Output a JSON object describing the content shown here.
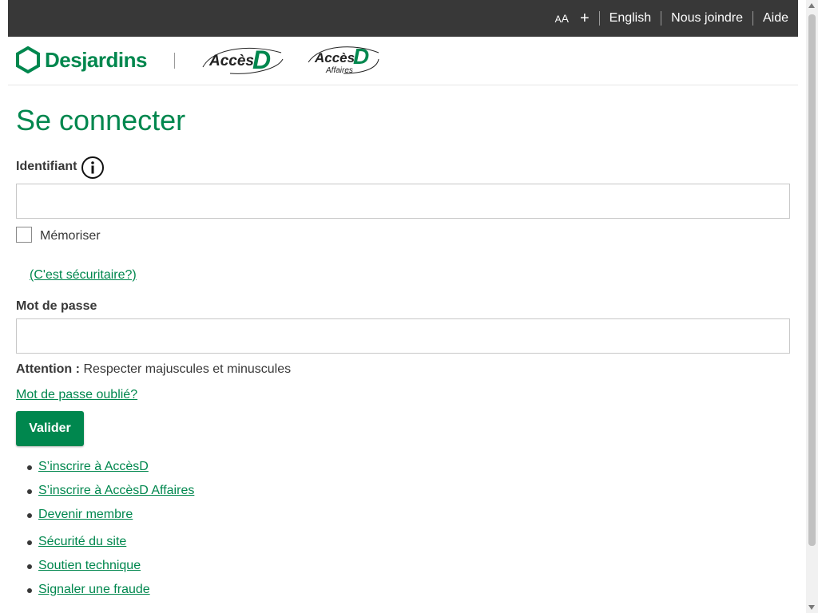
{
  "topbar": {
    "font_size_small": "A",
    "font_size_large": "A",
    "font_size_plus": "+",
    "english": "English",
    "contact": "Nous joindre",
    "help": "Aide"
  },
  "header": {
    "brand": "Desjardins",
    "acces_d_logo": "AccèsD",
    "acces_d_affaires_logo": "AccèsD Affaires"
  },
  "login": {
    "title": "Se connecter",
    "identifier_label": "Identifiant",
    "identifier_value": "",
    "remember_label": "Mémoriser",
    "is_secure_link": "(C'est sécuritaire?)",
    "password_label": "Mot de passe",
    "password_value": "",
    "attention_label": "Attention :",
    "attention_text": "Respecter majuscules et minuscules",
    "forgot_password_link": "Mot de passe oublié?",
    "submit_label": "Valider"
  },
  "links": [
    "S’inscrire à AccèsD",
    "S’inscrire à AccèsD Affaires",
    "Devenir membre",
    "Sécurité du site",
    "Soutien technique",
    "Signaler une fraude"
  ],
  "colors": {
    "brand_green": "#00874e",
    "topbar_bg": "#383838"
  }
}
